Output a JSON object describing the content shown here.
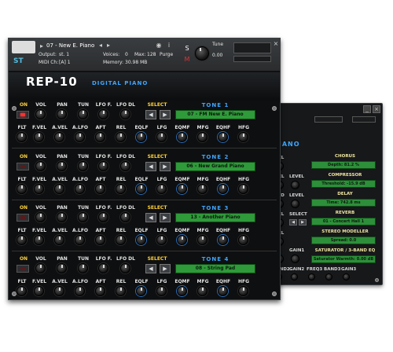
{
  "kontakt": {
    "instrument_name": "07 - New E. Piano",
    "output_label": "Output:",
    "output_value": "st. 1",
    "midi_label": "MIDI Ch:",
    "midi_value": "[A] 1",
    "voices_label": "Voices:",
    "voices_value": "0",
    "max_label": "Max:",
    "max_value": "128",
    "memory_label": "Memory:",
    "memory_value": "30.98 MB",
    "purge_label": "Purge",
    "tune_label": "Tune",
    "tune_value": "0.00",
    "st_label": "ST"
  },
  "header": {
    "title": "REP-10",
    "subtitle": "DIGITAL PIANO"
  },
  "rows": {
    "top_labels": [
      "ON",
      "VOL",
      "PAN",
      "TUN",
      "LFO F.",
      "LFO DL",
      "SELECT"
    ],
    "bottom_labels": [
      "FLT",
      "F.VEL",
      "A.VEL",
      "A.LFO",
      "AFT",
      "REL",
      "EQLF",
      "LFG",
      "EQMF",
      "MFG",
      "EQHF",
      "HFG"
    ]
  },
  "tones": [
    {
      "label": "TONE 1",
      "patch": "07 - FM New E. Piano",
      "on": true
    },
    {
      "label": "TONE 2",
      "patch": "06 - New Grand Piano",
      "on": false
    },
    {
      "label": "TONE 3",
      "patch": "13 - Another Piano",
      "on": false
    },
    {
      "label": "TONE 4",
      "patch": "08 - String Pad",
      "on": false
    }
  ],
  "back_panel": {
    "title_fragment": "PIANO",
    "chorus": {
      "label": "CHORUS",
      "value": "Depth: 81.2 %"
    },
    "compressor": {
      "label": "COMPRESSOR",
      "value": "Threshold: -15.9 dB"
    },
    "delay": {
      "label": "DELAY",
      "value": "Time: 742.8 ms"
    },
    "reverb": {
      "label": "REVERB",
      "value": "01 - Concert Hall 1"
    },
    "stereo": {
      "label": "STEREO MODELLER",
      "value": "Spread: 0.0"
    },
    "saturator": {
      "label": "SATURATOR / 3-BAND EQ",
      "value": "Saturator Warmth: 0.00 dB"
    },
    "labels": [
      "EVEL",
      "REL",
      "LEVEL",
      "FEED",
      "LEVEL",
      "EVEL",
      "SELECT",
      "EVEL",
      "GAIN1",
      "MAND2",
      "GAIN2",
      "FREQ3",
      "BAND3",
      "GAIN3"
    ]
  }
}
